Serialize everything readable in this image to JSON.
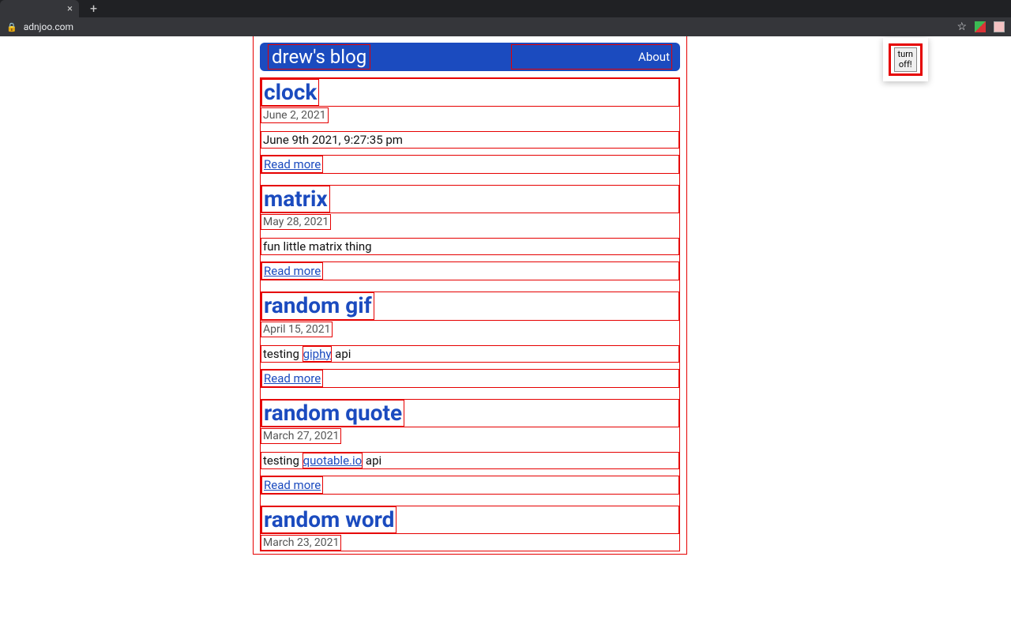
{
  "browser": {
    "url": "adnjoo.com",
    "tab_close_glyph": "×",
    "new_tab_glyph": "+",
    "star_glyph": "☆",
    "lock_glyph": "🔒"
  },
  "extension_popup": {
    "button_line1": "turn",
    "button_line2": "off!"
  },
  "header": {
    "title": "drew's blog",
    "about": "About"
  },
  "read_more_label": "Read more",
  "posts": [
    {
      "title": "clock",
      "date": "June 2, 2021",
      "excerpt_plain": "June 9th 2021, 9:27:35 pm"
    },
    {
      "title": "matrix",
      "date": "May 28, 2021",
      "excerpt_plain": "fun little matrix thing"
    },
    {
      "title": "random gif",
      "date": "April 15, 2021",
      "excerpt_prefix": "testing ",
      "excerpt_link": "giphy",
      "excerpt_suffix": " api"
    },
    {
      "title": "random quote",
      "date": "March 27, 2021",
      "excerpt_prefix": "testing ",
      "excerpt_link": "quotable.io",
      "excerpt_suffix": " api"
    },
    {
      "title": "random word",
      "date": "March 23, 2021"
    }
  ]
}
